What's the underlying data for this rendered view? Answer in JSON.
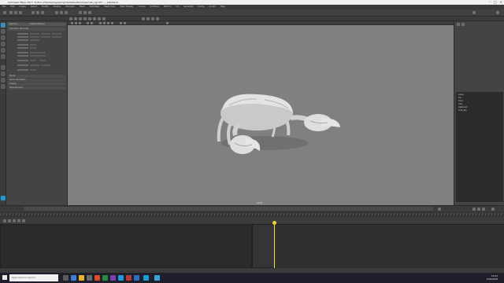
{
  "window": {
    "title": "Autodesk Maya 2017: D:/Documents/maya/projects/default/scenes/crab_rig.mb* --- pSphere1"
  },
  "menubar": {
    "items": [
      "File",
      "Edit",
      "Create",
      "Select",
      "Modify",
      "Display",
      "Windows",
      "Mesh",
      "Edit Mesh",
      "Mesh Tools",
      "Mesh Display",
      "Curves",
      "Surfaces",
      "Deform",
      "UV",
      "Generate",
      "Cache",
      "Arnold",
      "Help"
    ]
  },
  "attr_editor": {
    "tabs": [
      "pSphere1",
      "pSphereShape1"
    ],
    "section": "Transform Attributes",
    "sections": [
      "Pivots",
      "Limit Information",
      "Display",
      "Node Behavior"
    ]
  },
  "viewport": {
    "camera": "persp"
  },
  "outliner": {
    "items": [
      "persp",
      "top",
      "front",
      "side",
      "pSphere1",
      "Crab_Rig"
    ]
  },
  "taskbar": {
    "search_placeholder": "Type here to search",
    "time": "10:15",
    "date": "3/28/2018"
  },
  "colors": {
    "playhead": "#f2e23a",
    "viewport_bg": "#808080",
    "model": "#d8d8d8"
  }
}
